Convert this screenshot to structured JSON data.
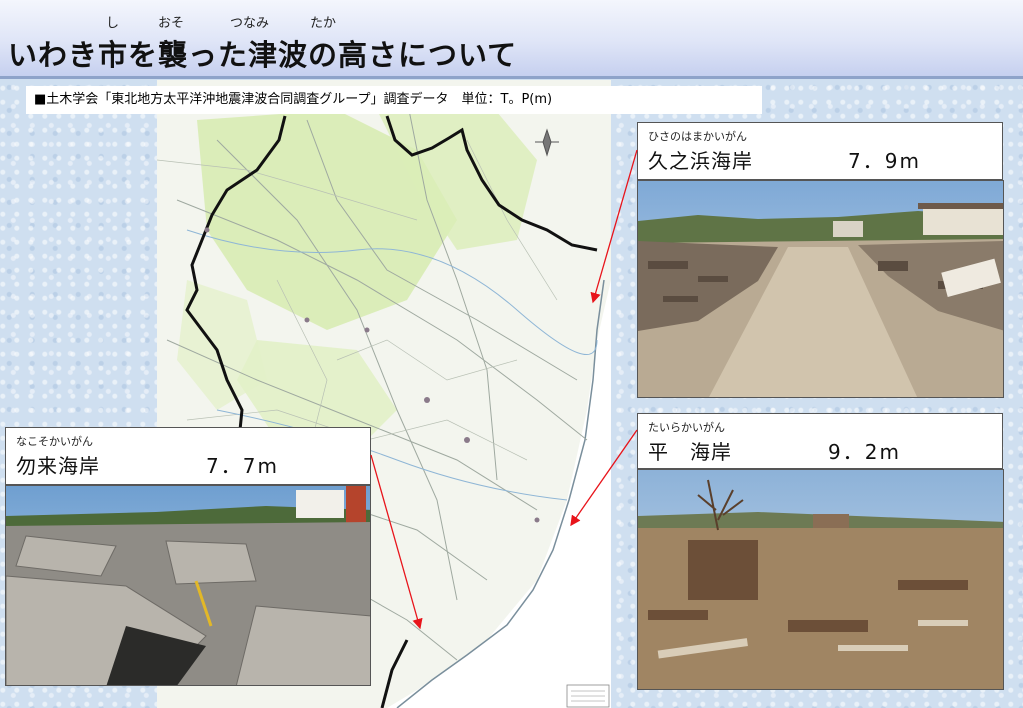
{
  "header": {
    "title": "いわき市を襲った津波の高さについて",
    "ruby": [
      "し",
      "おそ",
      "つなみ",
      "たか"
    ]
  },
  "source_note": "■土木学会「東北地方太平洋沖地震津波合同調査グループ」調査データ　単位：T。P(m)",
  "sites": [
    {
      "furigana": "ひさのはまかいがん",
      "name": "久之浜海岸",
      "height": "7．9m"
    },
    {
      "furigana": "たいらかいがん",
      "name": "平　海岸",
      "height": "9．2m"
    },
    {
      "furigana": "なこそかいがん",
      "name": "勿来海岸",
      "height": "7．7m"
    }
  ],
  "colors": {
    "arrow": "#e8141b",
    "boundary": "#111111",
    "forest": "#d6ecb0",
    "sea": "#ffffff"
  }
}
